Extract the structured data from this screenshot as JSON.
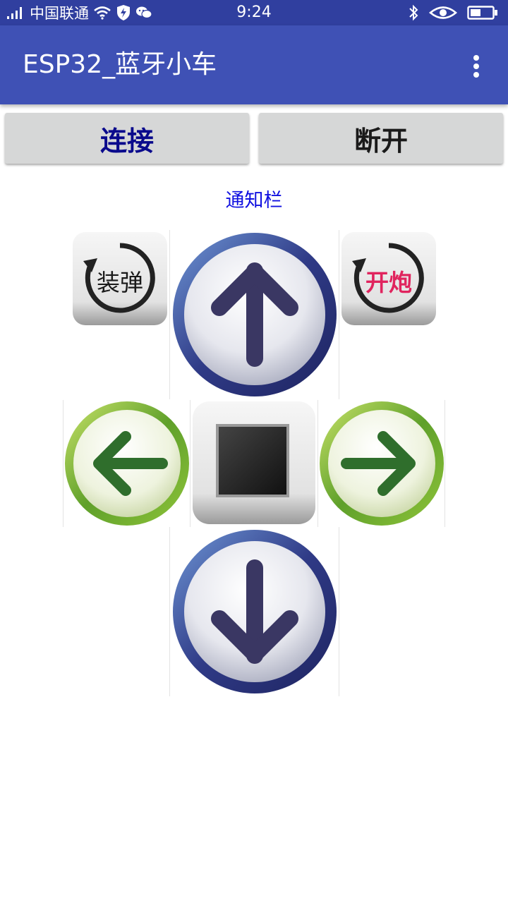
{
  "status_bar": {
    "carrier": "中国联通",
    "time": "9:24",
    "icons": [
      "signal-icon",
      "wifi-icon",
      "shield-icon",
      "wechat-icon",
      "bluetooth-icon",
      "eye-icon",
      "battery-icon"
    ]
  },
  "app_bar": {
    "title": "ESP32_蓝牙小车",
    "menu_icon": "overflow-menu-icon"
  },
  "buttons": {
    "connect_label": "连接",
    "disconnect_label": "断开"
  },
  "notification": {
    "text": "通知栏"
  },
  "controls": {
    "load_label": "装弹",
    "fire_label": "开炮",
    "up_icon": "arrow-up-icon",
    "down_icon": "arrow-down-icon",
    "left_icon": "arrow-left-icon",
    "right_icon": "arrow-right-icon",
    "stop_icon": "stop-icon"
  },
  "colors": {
    "status_bar": "#303f9f",
    "app_bar": "#3f51b5",
    "connect_text": "#0a0a8c",
    "notify_text": "#1010e0",
    "fire_text": "#e0245e"
  }
}
